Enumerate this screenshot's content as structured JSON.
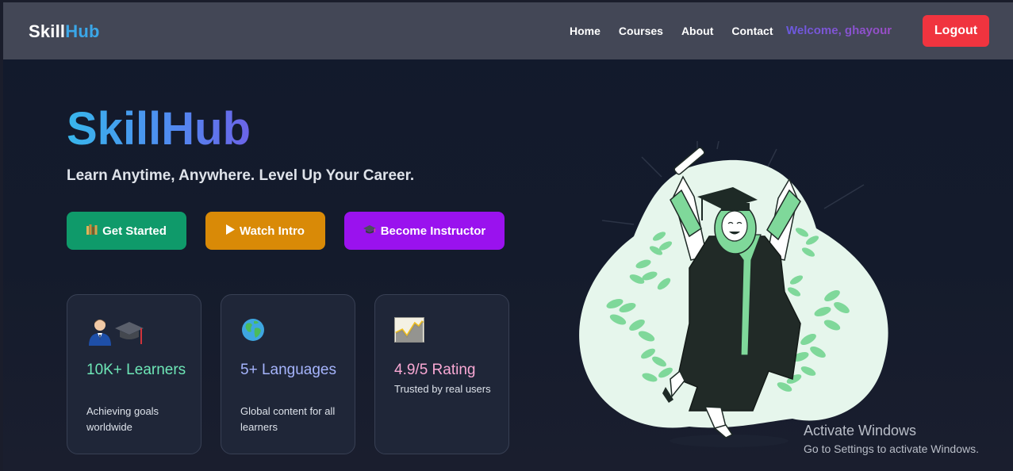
{
  "nav": {
    "brand_part1": "Skill",
    "brand_part2": "Hub",
    "links": [
      "Home",
      "Courses",
      "About",
      "Contact"
    ],
    "welcome": "Welcome, ghayour",
    "logout_label": "Logout"
  },
  "hero": {
    "title": "SkillHub",
    "tagline": "Learn Anytime, Anywhere. Level Up Your Career."
  },
  "buttons": {
    "get_started": {
      "icon": "books-icon",
      "label": "Get Started"
    },
    "watch_intro": {
      "icon": "play-icon",
      "label": "Watch Intro"
    },
    "become_instructor": {
      "icon": "graduation-cap-icon",
      "label": "Become Instructor"
    }
  },
  "stats": [
    {
      "icon": "learner-and-graduation-cap-icon",
      "stat": "10K+ Learners",
      "desc": "Achieving goals worldwide",
      "color": "#6ee7b7"
    },
    {
      "icon": "globe-icon",
      "stat": "5+ Languages",
      "desc": "Global content for all learners",
      "color": "#a5b4fc"
    },
    {
      "icon": "chart-increasing-icon",
      "stat": "4.9/5 Rating",
      "desc": "Trusted by real users",
      "color": "#f9a8d4"
    }
  ],
  "illustration": {
    "icon": "graduate-celebrating-illustration"
  },
  "overlay": {
    "activate_title": "Activate Windows",
    "activate_sub": "Go to Settings to activate Windows."
  },
  "colors": {
    "navbar": "#434756",
    "background": "#141b2c",
    "brand_accent": "#3aa7e8",
    "logout": "#f0343f",
    "get_started": "#0f9a6a",
    "watch_intro": "#d98a07",
    "become_instructor": "#9a12ee",
    "illustration_blob": "#e6f6ec",
    "illustration_leaf": "#7fd89a"
  }
}
